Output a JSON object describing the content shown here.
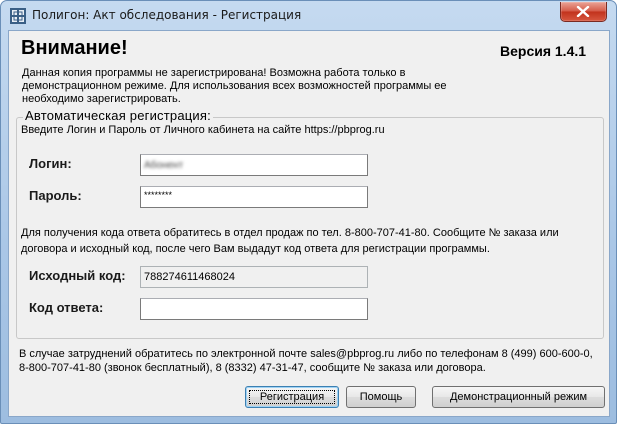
{
  "window": {
    "title": "Полигон: Акт обследования - Регистрация"
  },
  "header": {
    "heading": "Внимание!",
    "version": "Версия 1.4.1",
    "notice": "Данная копия программы не зарегистрирована! Возможна работа только в демонстрационном режиме. Для использования всех возможностей программы ее необходимо зарегистрировать."
  },
  "auto_registration": {
    "title": "Автоматическая регистрация:",
    "subtitle": "Введите Логин и Пароль от Личного кабинета на сайте https://pbprog.ru",
    "login_label": "Логин:",
    "login_value": "Абонент",
    "password_label": "Пароль:",
    "password_value": "********",
    "hint": "Для получения кода ответа обратитесь в отдел продаж по тел. 8-800-707-41-80. Сообщите № заказа или договора и исходный код, после чего Вам выдадут код ответа для регистрации программы.",
    "source_code_label": "Исходный код:",
    "source_code_value": "788274611468024",
    "answer_code_label": "Код ответа:",
    "answer_code_value": ""
  },
  "footer": {
    "text": "В случае затруднений обратитесь по электронной почте sales@pbprog.ru либо по телефонам 8 (499) 600-600-0, 8-800-707-41-80 (звонок бесплатный), 8 (8332) 47-31-47, сообщите № заказа или договора."
  },
  "buttons": {
    "register": "Регистрация",
    "help": "Помощь",
    "demo": "Демонстрационный режим"
  },
  "icons": {
    "app": "app-grid-icon",
    "close": "close-icon"
  },
  "colors": {
    "close_button": "#c8412a",
    "title_bar": "#b4cfec",
    "dialog_bg": "#f0f0f0"
  }
}
